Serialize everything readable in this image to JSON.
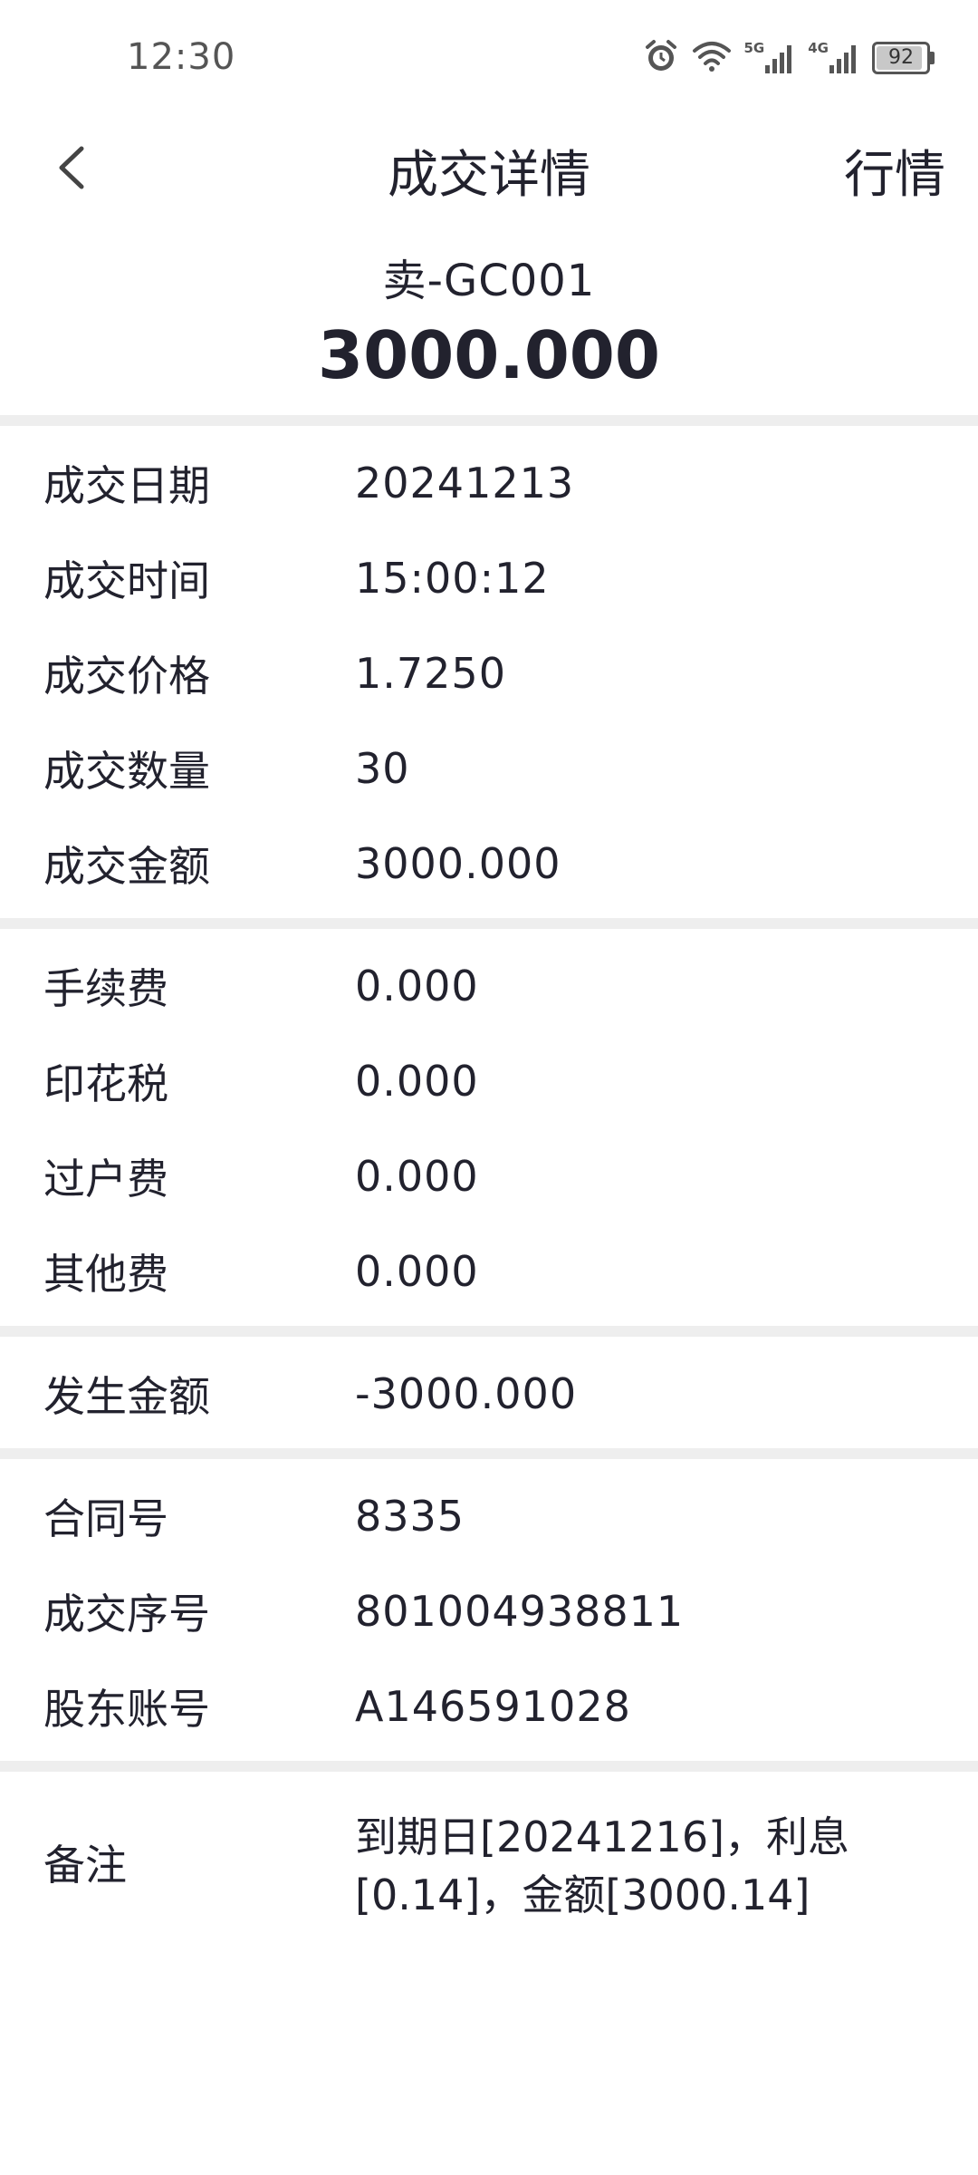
{
  "status_bar": {
    "time": "12:30",
    "battery": "92",
    "battery_level": 0.92,
    "network_5g": "5G",
    "network_4g": "4G",
    "icons": [
      "alarm-icon",
      "wifi-icon",
      "signal-5g-icon",
      "signal-4g-icon",
      "battery-icon"
    ]
  },
  "nav": {
    "title": "成交详情",
    "right_action": "行情",
    "back_icon": "chevron-left-icon"
  },
  "summary": {
    "code": "卖-GC001",
    "amount": "3000.000"
  },
  "sections": [
    {
      "rows": [
        {
          "label": "成交日期",
          "value": "20241213"
        },
        {
          "label": "成交时间",
          "value": "15:00:12"
        },
        {
          "label": "成交价格",
          "value": "1.7250"
        },
        {
          "label": "成交数量",
          "value": "30"
        },
        {
          "label": "成交金额",
          "value": "3000.000"
        }
      ]
    },
    {
      "rows": [
        {
          "label": "手续费",
          "value": "0.000"
        },
        {
          "label": "印花税",
          "value": "0.000"
        },
        {
          "label": "过户费",
          "value": "0.000"
        },
        {
          "label": "其他费",
          "value": "0.000"
        }
      ]
    },
    {
      "rows": [
        {
          "label": "发生金额",
          "value": "-3000.000"
        }
      ]
    },
    {
      "rows": [
        {
          "label": "合同号",
          "value": "8335"
        },
        {
          "label": "成交序号",
          "value": "801004938811"
        },
        {
          "label": "股东账号",
          "value": "A146591028"
        }
      ]
    }
  ],
  "remark": {
    "label": "备注",
    "lines": [
      "到期日[20241216]，利息",
      "[0.14]，金额[3000.14]"
    ]
  }
}
